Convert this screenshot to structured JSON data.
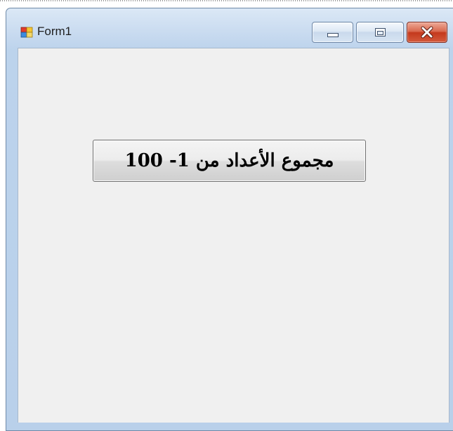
{
  "window": {
    "title": "Form1",
    "icon": "winforms-app-icon"
  },
  "caption_buttons": {
    "minimize_icon": "minimize-icon",
    "maximize_icon": "maximize-icon",
    "close_icon": "close-icon"
  },
  "form": {
    "button_label": "مجموع الأعداد من 1- 100"
  }
}
